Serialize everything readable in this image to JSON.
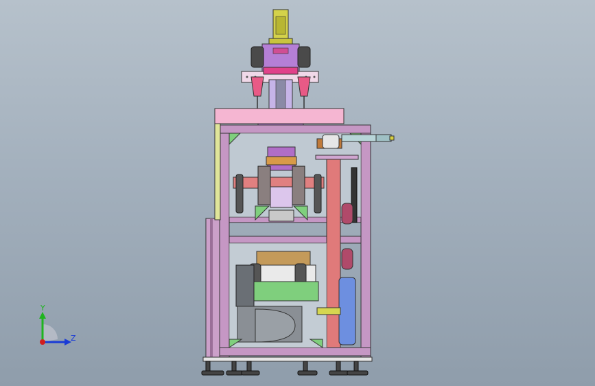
{
  "viewport": {
    "background_top": "#b6c1cb",
    "background_bottom": "#8f9dab"
  },
  "triad": {
    "y_label": "Y",
    "z_label": "Z",
    "y_color": "#1fb41f",
    "z_color": "#1a3bd6",
    "x_color": "#d21e1e"
  },
  "model": {
    "frame_color": "#c79ac6",
    "frame_edge": "#3a2a3a",
    "pink_panel": "#f2b7d3",
    "green_plate": "#7fcf7d",
    "purple_block": "#b06ec7",
    "cylinder_blue": "#6d8fe0",
    "rod_red": "#e07878",
    "olive": "#d6d650",
    "dark": "#4a4a4a",
    "grey_motor": "#8a8f95"
  }
}
